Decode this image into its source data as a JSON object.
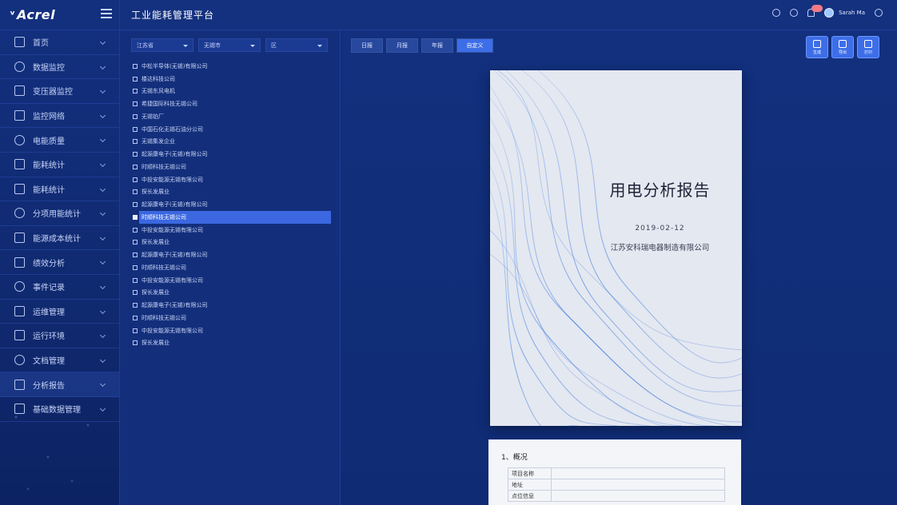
{
  "brand": {
    "logo": "Acrel"
  },
  "header": {
    "title": "工业能耗管理平台",
    "user_name": "Sarah Ma",
    "icons": [
      "search-icon",
      "fullscreen-icon",
      "bell-icon",
      "settings-icon"
    ]
  },
  "sidebar": {
    "items": [
      {
        "label": "首页",
        "icon": "home-icon"
      },
      {
        "label": "数据监控",
        "icon": "chart-icon"
      },
      {
        "label": "变压器监控",
        "icon": "transformer-icon"
      },
      {
        "label": "监控网络",
        "icon": "network-icon"
      },
      {
        "label": "电能质量",
        "icon": "quality-icon"
      },
      {
        "label": "能耗统计",
        "icon": "bar-chart-icon"
      },
      {
        "label": "能耗统计",
        "icon": "nodes-icon"
      },
      {
        "label": "分项用能统计",
        "icon": "location-icon"
      },
      {
        "label": "能源成本统计",
        "icon": "cost-icon"
      },
      {
        "label": "绩效分析",
        "icon": "trend-icon"
      },
      {
        "label": "事件记录",
        "icon": "event-icon"
      },
      {
        "label": "运维管理",
        "icon": "maintenance-icon"
      },
      {
        "label": "运行环境",
        "icon": "environment-icon"
      },
      {
        "label": "文档管理",
        "icon": "document-icon"
      },
      {
        "label": "分析报告",
        "icon": "report-icon"
      },
      {
        "label": "基础数据管理",
        "icon": "database-icon"
      }
    ]
  },
  "filters": {
    "province": "江苏省",
    "city": "无锡市",
    "district": "区"
  },
  "companies": [
    {
      "name": "中松半导体(无锡)有限公司",
      "checked": false
    },
    {
      "name": "楼达科技公司",
      "checked": false
    },
    {
      "name": "无锡东风电机",
      "checked": false
    },
    {
      "name": "希捷国际科技无锡公司",
      "checked": false
    },
    {
      "name": "无锡铂厂",
      "checked": false
    },
    {
      "name": "中国石化无锡石油分公司",
      "checked": false
    },
    {
      "name": "无锡集发企业",
      "checked": false
    },
    {
      "name": "起源康电子(无锡)有限公司",
      "checked": false
    },
    {
      "name": "时顺科技无锡公司",
      "checked": false
    },
    {
      "name": "中投安能源无锡有限公司",
      "checked": false
    },
    {
      "name": "探长发展业",
      "checked": false
    },
    {
      "name": "起源康电子(无锡)有限公司",
      "checked": false
    },
    {
      "name": "时顺科技无锡公司",
      "checked": true
    },
    {
      "name": "中投安能源无锡有限公司",
      "checked": false
    },
    {
      "name": "探长发展业",
      "checked": false
    },
    {
      "name": "起源康电子(无锡)有限公司",
      "checked": false
    },
    {
      "name": "时顺科技无锡公司",
      "checked": false
    },
    {
      "name": "中投安能源无锡有限公司",
      "checked": false
    },
    {
      "name": "探长发展业",
      "checked": false
    },
    {
      "name": "起源康电子(无锡)有限公司",
      "checked": false
    },
    {
      "name": "时顺科技无锡公司",
      "checked": false
    },
    {
      "name": "中投安能源无锡有限公司",
      "checked": false
    },
    {
      "name": "探长发展业",
      "checked": false
    }
  ],
  "period_tabs": [
    {
      "label": "日报",
      "active": false
    },
    {
      "label": "月报",
      "active": false
    },
    {
      "label": "年报",
      "active": false
    },
    {
      "label": "自定义",
      "active": true
    }
  ],
  "actions": [
    {
      "label": "生成",
      "icon": "generate-icon"
    },
    {
      "label": "导出",
      "icon": "export-icon"
    },
    {
      "label": "打印",
      "icon": "print-icon"
    }
  ],
  "report": {
    "title": "用电分析报告",
    "date": "2019-02-12",
    "company": "江苏安科瑞电器制造有限公司",
    "section_title": "1、概况",
    "rows": [
      {
        "key": "项目名称",
        "value": ""
      },
      {
        "key": "地址",
        "value": ""
      },
      {
        "key": "点位信息",
        "value": ""
      }
    ]
  },
  "colors": {
    "accent": "#3d6ee8",
    "background": "#0f2a78",
    "selected_row": "#3b68e0"
  }
}
